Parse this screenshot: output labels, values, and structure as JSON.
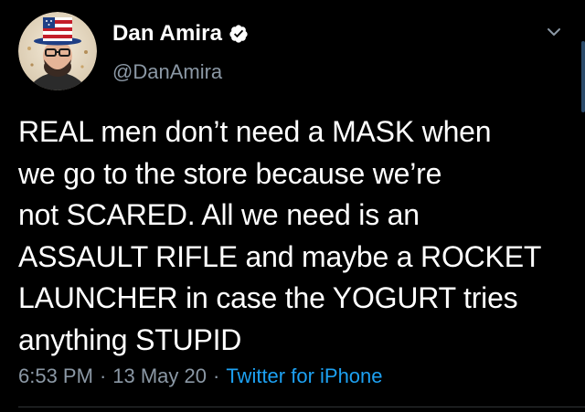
{
  "tweet": {
    "author": {
      "display_name": "Dan Amira",
      "handle": "@DanAmira",
      "verified": true
    },
    "text": "REAL men don’t need a MASK when\nwe go to the store because we’re\nnot SCARED. All we need is an\nASSAULT RIFLE and maybe a ROCKET\nLAUNCHER in case the YOGURT tries\nanything STUPID",
    "time": "6:53 PM",
    "separator_1": "·",
    "date": "13 May 20",
    "separator_2": "·",
    "source": "Twitter for iPhone"
  },
  "colors": {
    "background": "#000000",
    "text_primary": "#ffffff",
    "text_secondary": "#8b98a5",
    "link": "#1da1f2"
  },
  "icons": {
    "verified": "verified-badge-icon",
    "menu": "chevron-down-icon"
  }
}
